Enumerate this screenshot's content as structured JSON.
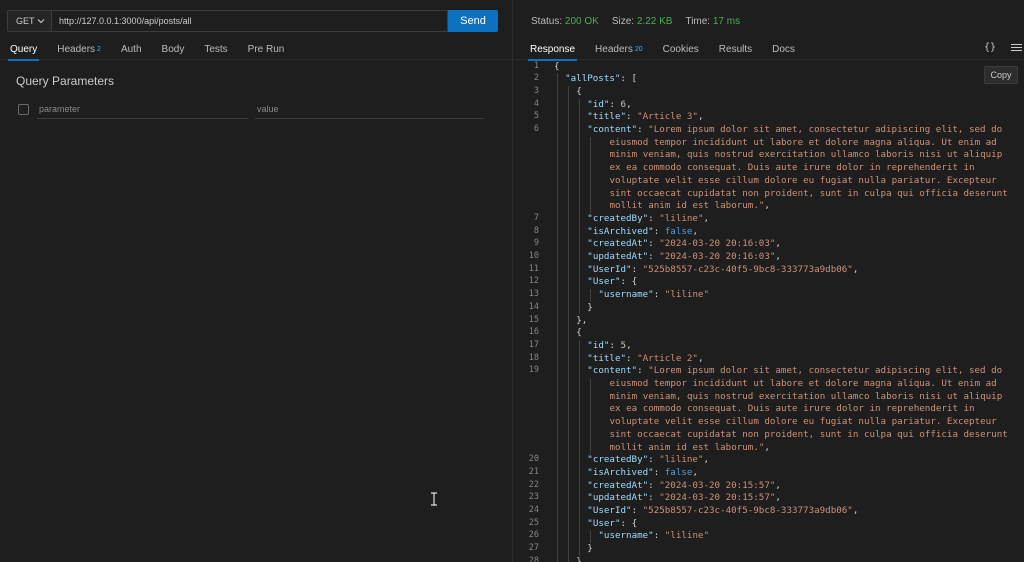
{
  "request": {
    "method": "GET",
    "url": "http://127.0.0.1:3000/api/posts/all",
    "send_label": "Send",
    "tabs": [
      {
        "label": "Query",
        "badge": ""
      },
      {
        "label": "Headers",
        "badge": "2"
      },
      {
        "label": "Auth",
        "badge": ""
      },
      {
        "label": "Body",
        "badge": ""
      },
      {
        "label": "Tests",
        "badge": ""
      },
      {
        "label": "Pre Run",
        "badge": ""
      }
    ],
    "query": {
      "title": "Query Parameters",
      "param_placeholder": "parameter",
      "value_placeholder": "value"
    }
  },
  "response": {
    "status_label": "Status:",
    "status_value": "200 OK",
    "size_label": "Size:",
    "size_value": "2.22 KB",
    "time_label": "Time:",
    "time_value": "17 ms",
    "tabs": [
      {
        "label": "Response",
        "badge": ""
      },
      {
        "label": "Headers",
        "badge": "20"
      },
      {
        "label": "Cookies",
        "badge": ""
      },
      {
        "label": "Results",
        "badge": ""
      },
      {
        "label": "Docs",
        "badge": ""
      }
    ],
    "braces_icon": "{}",
    "copy_label": "Copy",
    "code_lines": [
      {
        "n": "1",
        "indent": 0,
        "parts": [
          [
            "p",
            "{"
          ]
        ]
      },
      {
        "n": "2",
        "indent": 1,
        "parts": [
          [
            "k",
            "\"allPosts\""
          ],
          [
            "p",
            ": ["
          ]
        ]
      },
      {
        "n": "3",
        "indent": 2,
        "parts": [
          [
            "p",
            "{"
          ]
        ]
      },
      {
        "n": "4",
        "indent": 3,
        "parts": [
          [
            "k",
            "\"id\""
          ],
          [
            "p",
            ": "
          ],
          [
            "n",
            "6"
          ],
          [
            "p",
            ","
          ]
        ]
      },
      {
        "n": "5",
        "indent": 3,
        "parts": [
          [
            "k",
            "\"title\""
          ],
          [
            "p",
            ": "
          ],
          [
            "s",
            "\"Article 3\""
          ],
          [
            "p",
            ","
          ]
        ]
      },
      {
        "n": "6",
        "indent": 3,
        "parts": [
          [
            "k",
            "\"content\""
          ],
          [
            "p",
            ": "
          ],
          [
            "s",
            "\"Lorem ipsum dolor sit amet, consectetur adipiscing elit, sed do"
          ]
        ]
      },
      {
        "n": "",
        "indent": 5,
        "parts": [
          [
            "s",
            "eiusmod tempor incididunt ut labore et dolore magna aliqua. Ut enim ad"
          ]
        ]
      },
      {
        "n": "",
        "indent": 5,
        "parts": [
          [
            "s",
            "minim veniam, quis nostrud exercitation ullamco laboris nisi ut aliquip"
          ]
        ]
      },
      {
        "n": "",
        "indent": 5,
        "parts": [
          [
            "s",
            "ex ea commodo consequat. Duis aute irure dolor in reprehenderit in"
          ]
        ]
      },
      {
        "n": "",
        "indent": 5,
        "parts": [
          [
            "s",
            "voluptate velit esse cillum dolore eu fugiat nulla pariatur. Excepteur"
          ]
        ]
      },
      {
        "n": "",
        "indent": 5,
        "parts": [
          [
            "s",
            "sint occaecat cupidatat non proident, sunt in culpa qui officia deserunt"
          ]
        ]
      },
      {
        "n": "",
        "indent": 5,
        "parts": [
          [
            "s",
            "mollit anim id est laborum.\""
          ],
          [
            "p",
            ","
          ]
        ]
      },
      {
        "n": "7",
        "indent": 3,
        "parts": [
          [
            "k",
            "\"createdBy\""
          ],
          [
            "p",
            ": "
          ],
          [
            "s",
            "\"liline\""
          ],
          [
            "p",
            ","
          ]
        ]
      },
      {
        "n": "8",
        "indent": 3,
        "parts": [
          [
            "k",
            "\"isArchived\""
          ],
          [
            "p",
            ": "
          ],
          [
            "b",
            "false"
          ],
          [
            "p",
            ","
          ]
        ]
      },
      {
        "n": "9",
        "indent": 3,
        "parts": [
          [
            "k",
            "\"createdAt\""
          ],
          [
            "p",
            ": "
          ],
          [
            "s",
            "\"2024-03-20 20:16:03\""
          ],
          [
            "p",
            ","
          ]
        ]
      },
      {
        "n": "10",
        "indent": 3,
        "parts": [
          [
            "k",
            "\"updatedAt\""
          ],
          [
            "p",
            ": "
          ],
          [
            "s",
            "\"2024-03-20 20:16:03\""
          ],
          [
            "p",
            ","
          ]
        ]
      },
      {
        "n": "11",
        "indent": 3,
        "parts": [
          [
            "k",
            "\"UserId\""
          ],
          [
            "p",
            ": "
          ],
          [
            "s",
            "\"525b8557-c23c-40f5-9bc8-333773a9db06\""
          ],
          [
            "p",
            ","
          ]
        ]
      },
      {
        "n": "12",
        "indent": 3,
        "parts": [
          [
            "k",
            "\"User\""
          ],
          [
            "p",
            ": {"
          ]
        ]
      },
      {
        "n": "13",
        "indent": 4,
        "parts": [
          [
            "k",
            "\"username\""
          ],
          [
            "p",
            ": "
          ],
          [
            "s",
            "\"liline\""
          ]
        ]
      },
      {
        "n": "14",
        "indent": 3,
        "parts": [
          [
            "p",
            "}"
          ]
        ]
      },
      {
        "n": "15",
        "indent": 2,
        "parts": [
          [
            "p",
            "},"
          ]
        ]
      },
      {
        "n": "16",
        "indent": 2,
        "parts": [
          [
            "p",
            "{"
          ]
        ]
      },
      {
        "n": "17",
        "indent": 3,
        "parts": [
          [
            "k",
            "\"id\""
          ],
          [
            "p",
            ": "
          ],
          [
            "n",
            "5"
          ],
          [
            "p",
            ","
          ]
        ]
      },
      {
        "n": "18",
        "indent": 3,
        "parts": [
          [
            "k",
            "\"title\""
          ],
          [
            "p",
            ": "
          ],
          [
            "s",
            "\"Article 2\""
          ],
          [
            "p",
            ","
          ]
        ]
      },
      {
        "n": "19",
        "indent": 3,
        "parts": [
          [
            "k",
            "\"content\""
          ],
          [
            "p",
            ": "
          ],
          [
            "s",
            "\"Lorem ipsum dolor sit amet, consectetur adipiscing elit, sed do"
          ]
        ]
      },
      {
        "n": "",
        "indent": 5,
        "parts": [
          [
            "s",
            "eiusmod tempor incididunt ut labore et dolore magna aliqua. Ut enim ad"
          ]
        ]
      },
      {
        "n": "",
        "indent": 5,
        "parts": [
          [
            "s",
            "minim veniam, quis nostrud exercitation ullamco laboris nisi ut aliquip"
          ]
        ]
      },
      {
        "n": "",
        "indent": 5,
        "parts": [
          [
            "s",
            "ex ea commodo consequat. Duis aute irure dolor in reprehenderit in"
          ]
        ]
      },
      {
        "n": "",
        "indent": 5,
        "parts": [
          [
            "s",
            "voluptate velit esse cillum dolore eu fugiat nulla pariatur. Excepteur"
          ]
        ]
      },
      {
        "n": "",
        "indent": 5,
        "parts": [
          [
            "s",
            "sint occaecat cupidatat non proident, sunt in culpa qui officia deserunt"
          ]
        ]
      },
      {
        "n": "",
        "indent": 5,
        "parts": [
          [
            "s",
            "mollit anim id est laborum.\""
          ],
          [
            "p",
            ","
          ]
        ]
      },
      {
        "n": "20",
        "indent": 3,
        "parts": [
          [
            "k",
            "\"createdBy\""
          ],
          [
            "p",
            ": "
          ],
          [
            "s",
            "\"liline\""
          ],
          [
            "p",
            ","
          ]
        ]
      },
      {
        "n": "21",
        "indent": 3,
        "parts": [
          [
            "k",
            "\"isArchived\""
          ],
          [
            "p",
            ": "
          ],
          [
            "b",
            "false"
          ],
          [
            "p",
            ","
          ]
        ]
      },
      {
        "n": "22",
        "indent": 3,
        "parts": [
          [
            "k",
            "\"createdAt\""
          ],
          [
            "p",
            ": "
          ],
          [
            "s",
            "\"2024-03-20 20:15:57\""
          ],
          [
            "p",
            ","
          ]
        ]
      },
      {
        "n": "23",
        "indent": 3,
        "parts": [
          [
            "k",
            "\"updatedAt\""
          ],
          [
            "p",
            ": "
          ],
          [
            "s",
            "\"2024-03-20 20:15:57\""
          ],
          [
            "p",
            ","
          ]
        ]
      },
      {
        "n": "24",
        "indent": 3,
        "parts": [
          [
            "k",
            "\"UserId\""
          ],
          [
            "p",
            ": "
          ],
          [
            "s",
            "\"525b8557-c23c-40f5-9bc8-333773a9db06\""
          ],
          [
            "p",
            ","
          ]
        ]
      },
      {
        "n": "25",
        "indent": 3,
        "parts": [
          [
            "k",
            "\"User\""
          ],
          [
            "p",
            ": {"
          ]
        ]
      },
      {
        "n": "26",
        "indent": 4,
        "parts": [
          [
            "k",
            "\"username\""
          ],
          [
            "p",
            ": "
          ],
          [
            "s",
            "\"liline\""
          ]
        ]
      },
      {
        "n": "27",
        "indent": 3,
        "parts": [
          [
            "p",
            "}"
          ]
        ]
      },
      {
        "n": "28",
        "indent": 2,
        "parts": [
          [
            "p",
            "},"
          ]
        ]
      }
    ]
  }
}
